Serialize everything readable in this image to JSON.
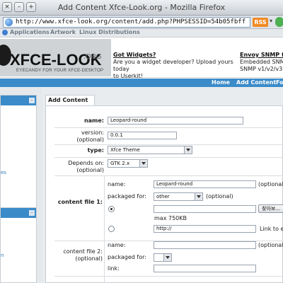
{
  "window": {
    "title": "Add Content Xfce-Look.org - Mozilla Firefox"
  },
  "address_bar": {
    "url": "http://www.xfce-look.org/content/add.php?PHPSESSID=54b05fbff",
    "rss_label": "RSS"
  },
  "site_nav": {
    "items": [
      "Applications",
      "Artwork",
      "Linux Distributions"
    ]
  },
  "header": {
    "logo_text": "XFCE-LOOK",
    "logo_suffix": ".ORG",
    "logo_tagline": "EYECANDY FOR YOUR XFCE-DESKTOP",
    "ad1": {
      "title": "Got Widgets?",
      "line1": "Are you a widget developer? Upload yours today",
      "line2": "to Userkit!"
    },
    "ad2": {
      "title": "Envoy SNMP fo",
      "line1": "Embedded SNMP",
      "line2": "SNMP v1/v2/v3"
    }
  },
  "menu": {
    "items": [
      "Home",
      "Add Content",
      "Fo"
    ]
  },
  "sidebar": {
    "link1": "es",
    "link2": "n"
  },
  "content": {
    "tab_label": "Add Content",
    "form": {
      "name_label": "name:",
      "name_value": "Leopard-round",
      "version_label": "version:",
      "version_optional": "(optional)",
      "version_value": "0.0.1",
      "type_label": "type:",
      "type_value": "Xfce Theme",
      "depends_label": "Depends on:",
      "depends_optional": "(optional)",
      "depends_value": "GTK 2.x",
      "file1": {
        "label": "content file 1:",
        "name_label": "name:",
        "name_value": "Leopard-round",
        "name_optional": "(optional",
        "packaged_label": "packaged for:",
        "packaged_value": "other",
        "packaged_optional": "(optional)",
        "browse_label": "찾아보...",
        "max_size": "max 750KB",
        "link_value": "http://",
        "link_label": "Link to e"
      },
      "file2": {
        "label": "content file 2:",
        "optional": "(optional)",
        "name_label": "name:",
        "name_optional": "(optional",
        "packaged_label": "packaged for:",
        "link_label": "link:"
      }
    }
  }
}
